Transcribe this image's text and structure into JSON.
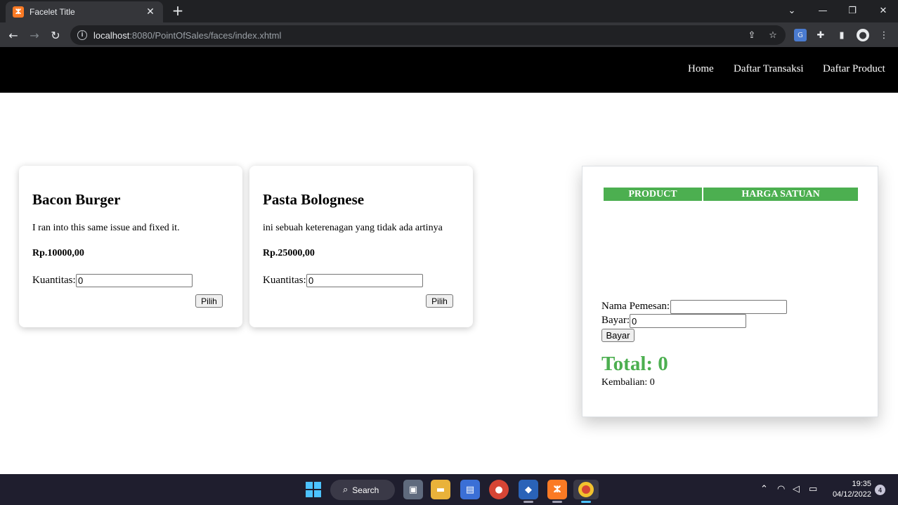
{
  "browser": {
    "tab_title": "Facelet Title",
    "tab_close": "✕",
    "new_tab": "+",
    "url_host": "localhost",
    "url_path": ":8080/PointOfSales/faces/index.xhtml",
    "window_controls": {
      "minimize": "—",
      "restore": "❐",
      "close": "✕",
      "tab_list": "⌄"
    },
    "nav": {
      "back": "←",
      "forward": "→",
      "reload": "↻"
    }
  },
  "nav": {
    "home": "Home",
    "transactions": "Daftar Transaksi",
    "products": "Daftar Product"
  },
  "products": [
    {
      "name": "Bacon Burger",
      "description": "I ran into this same issue and fixed it.",
      "price": "Rp.10000,00",
      "qty_label": "Kuantitas:",
      "qty_value": "0",
      "button": "Pilih"
    },
    {
      "name": "Pasta Bolognese",
      "description": "ini sebuah keterenagan yang tidak ada artinya",
      "price": "Rp.25000,00",
      "qty_label": "Kuantitas:",
      "qty_value": "0",
      "button": "Pilih"
    }
  ],
  "order": {
    "col_product": "PRODUCT",
    "col_price": "HARGA SATUAN",
    "name_label": "Nama Pemesan:",
    "name_value": "",
    "pay_label": "Bayar:",
    "pay_value": "0",
    "pay_button": "Bayar",
    "total": "Total: 0",
    "change": "Kembalian: 0"
  },
  "taskbar": {
    "search_label": "Search",
    "time": "19:35",
    "date": "04/12/2022",
    "notifications": "4"
  },
  "colors": {
    "accent_green": "#4caf50",
    "nav_bg": "#000000",
    "chrome_dark": "#202124",
    "taskbar_bg": "#1f1e2e"
  }
}
